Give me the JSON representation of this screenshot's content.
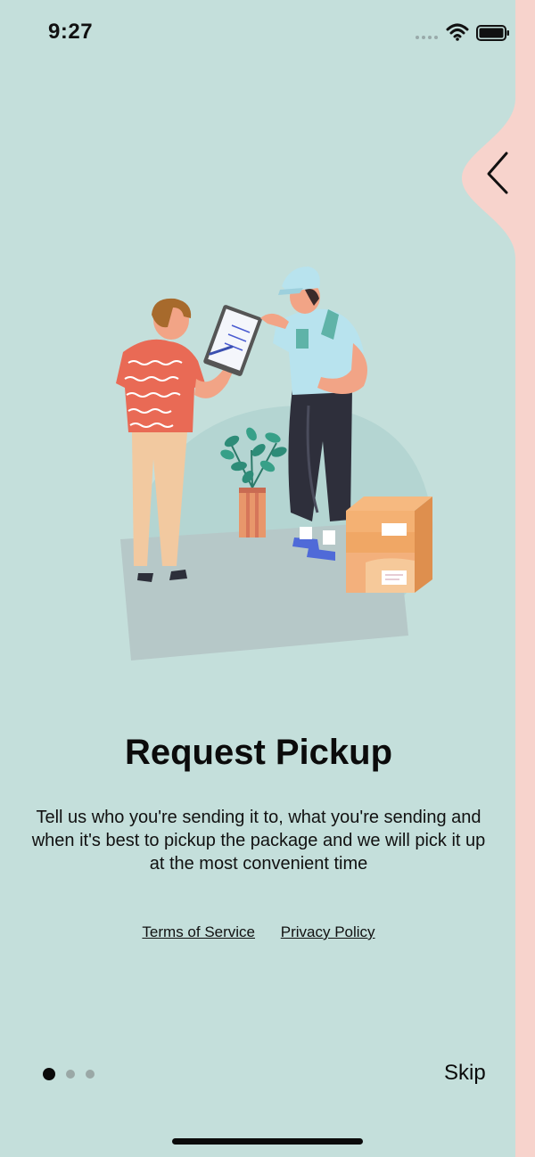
{
  "status_bar": {
    "time": "9:27"
  },
  "onboarding": {
    "title": "Request Pickup",
    "description": "Tell us who you're sending it to, what you're sending and when it's best to pickup the package and we will pick it up at the most convenient time",
    "terms_label": "Terms of Service",
    "privacy_label": "Privacy Policy",
    "skip_label": "Skip",
    "page_count": 3,
    "current_page": 1
  },
  "icons": {
    "back": "chevron-left-icon",
    "signal": "signal-icon",
    "wifi": "wifi-icon",
    "battery": "battery-icon"
  },
  "colors": {
    "background": "#c4dfdb",
    "accent_strip": "#f7d3cc",
    "text": "#0b0b0b",
    "dot_inactive": "#9aa8a6"
  }
}
